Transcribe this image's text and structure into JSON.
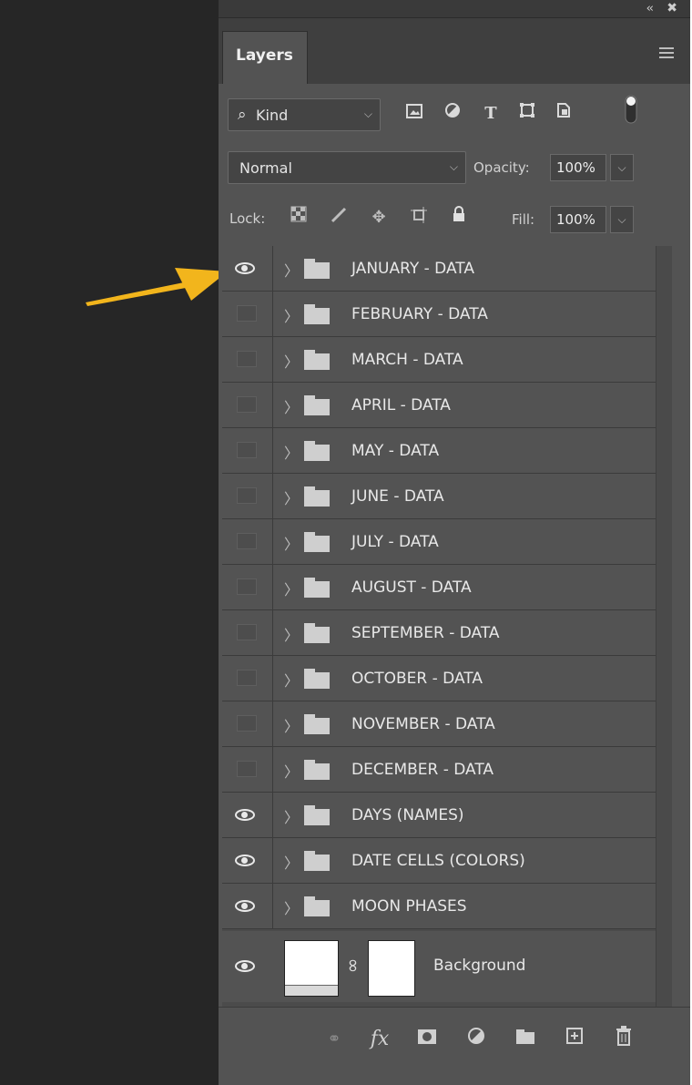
{
  "panel": {
    "tab_label": "Layers",
    "collapse_glyph": "‹‹",
    "close_glyph": "✖"
  },
  "filter": {
    "kind_label": "Kind",
    "icons": [
      "pixel-filter-icon",
      "adjustment-filter-icon",
      "type-filter-icon",
      "shape-filter-icon",
      "smart-object-filter-icon",
      "filter-toggle-icon"
    ]
  },
  "blend": {
    "mode": "Normal",
    "opacity_label": "Opacity:",
    "opacity_value": "100%"
  },
  "lock": {
    "label": "Lock:",
    "icons": [
      "lock-transparent-icon",
      "lock-image-icon",
      "lock-position-icon",
      "lock-artboard-icon",
      "lock-all-icon"
    ],
    "fill_label": "Fill:",
    "fill_value": "100%"
  },
  "layers": [
    {
      "name": "JANUARY - DATA",
      "visible": true
    },
    {
      "name": "FEBRUARY - DATA",
      "visible": false
    },
    {
      "name": "MARCH - DATA",
      "visible": false
    },
    {
      "name": "APRIL - DATA",
      "visible": false
    },
    {
      "name": "MAY - DATA",
      "visible": false
    },
    {
      "name": "JUNE - DATA",
      "visible": false
    },
    {
      "name": "JULY - DATA",
      "visible": false
    },
    {
      "name": "AUGUST - DATA",
      "visible": false
    },
    {
      "name": "SEPTEMBER - DATA",
      "visible": false
    },
    {
      "name": "OCTOBER - DATA",
      "visible": false
    },
    {
      "name": "NOVEMBER - DATA",
      "visible": false
    },
    {
      "name": "DECEMBER - DATA",
      "visible": false
    },
    {
      "name": "DAYS (NAMES)",
      "visible": true
    },
    {
      "name": "DATE CELLS (COLORS)",
      "visible": true
    },
    {
      "name": "MOON PHASES",
      "visible": true
    }
  ],
  "background_layer": {
    "name": "Background",
    "visible": true
  },
  "bottom_icons": [
    "link-layers-icon",
    "fx-icon",
    "add-mask-icon",
    "adjustment-layer-icon",
    "new-group-icon",
    "new-layer-icon",
    "delete-layer-icon"
  ],
  "colors": {
    "panel": "#535353",
    "arrow": "#f2b51c"
  }
}
